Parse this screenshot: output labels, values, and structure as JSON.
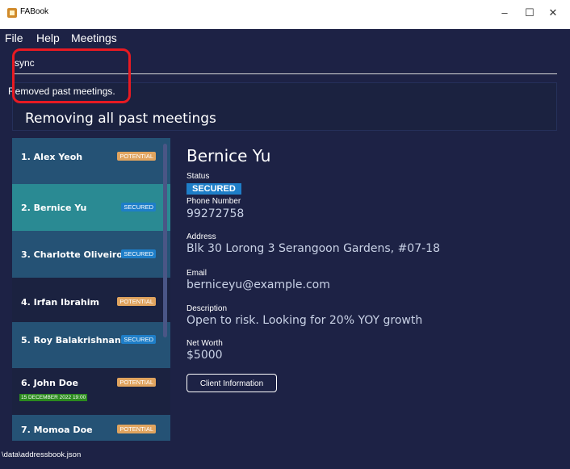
{
  "window": {
    "title": "FABook",
    "controls": [
      "–",
      "☐",
      "✕"
    ]
  },
  "menu": {
    "file": "File",
    "help": "Help",
    "meetings": "Meetings"
  },
  "command": {
    "value": "sync"
  },
  "result": {
    "message": "Removed past meetings."
  },
  "caption": "Removing all past meetings",
  "persons": [
    {
      "index_name": "1. Alex Yeoh",
      "badge": "POTENTIAL"
    },
    {
      "index_name": "2. Bernice Yu",
      "badge": "SECURED"
    },
    {
      "index_name": "3. Charlotte Oliveiro",
      "badge": "SECURED"
    },
    {
      "index_name": "4. Irfan Ibrahim",
      "badge": "POTENTIAL"
    },
    {
      "index_name": "5. Roy Balakrishnan",
      "badge": "SECURED"
    },
    {
      "index_name": "6. John Doe",
      "badge": "POTENTIAL",
      "meeting": "15 DECEMBER 2022 19:00"
    },
    {
      "index_name": "7. Momoa Doe",
      "badge": "POTENTIAL"
    }
  ],
  "details": {
    "name": "Bernice Yu",
    "status_label": "Status",
    "status": "SECURED",
    "phone_label": "Phone Number",
    "phone": "99272758",
    "address_label": "Address",
    "address": "Blk 30 Lorong 3 Serangoon Gardens, #07-18",
    "email_label": "Email",
    "email": "berniceyu@example.com",
    "description_label": "Description",
    "description": "Open to risk. Looking for 20% YOY growth",
    "networth_label": "Net Worth",
    "networth": "$5000",
    "client_button": "Client Information"
  },
  "statusbar": {
    "path": "\\data\\addressbook.json"
  },
  "colors": {
    "background": "#1d2245",
    "card_dark": "#1b2240",
    "card_light": "#255275",
    "card_selected": "#2a8a93",
    "potential": "#e0a45f",
    "secured": "#1e7ec8",
    "meeting_tag": "#2b8a1e",
    "highlight": "#e81a22"
  }
}
